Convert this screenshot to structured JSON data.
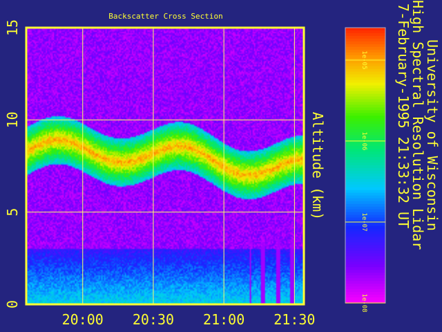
{
  "chart_data": {
    "type": "heatmap",
    "title": "Backscatter Cross Section",
    "side_title": "University of Wisconsin",
    "side_subtitle": "High Spectral Resolution Lidar",
    "side_date": "7-February-1995 21:33:32 UT",
    "xlabel": "",
    "ylabel": "Altitude (km)",
    "x_ticks": [
      "20:00",
      "20:30",
      "21:00",
      "21:30"
    ],
    "y_ticks": [
      "0",
      "5",
      "10",
      "15"
    ],
    "y_tick_values": [
      0,
      5,
      10,
      15
    ],
    "ylim": [
      0,
      15
    ],
    "x_tick_values_min": [
      0,
      30,
      60,
      90
    ],
    "xlim_min": [
      -24,
      94
    ],
    "colorbar": {
      "ticks": [
        "1e-05",
        "1e-06",
        "1e-07",
        "1e-08"
      ],
      "tick_exponents": [
        -5,
        -6,
        -7,
        -8
      ],
      "range_exponents": [
        -8,
        -4.6
      ],
      "scale": "log"
    },
    "grid": true,
    "colors": {
      "background": "#24247f",
      "frame": "#ffff33",
      "grid": "#ffff66"
    }
  }
}
